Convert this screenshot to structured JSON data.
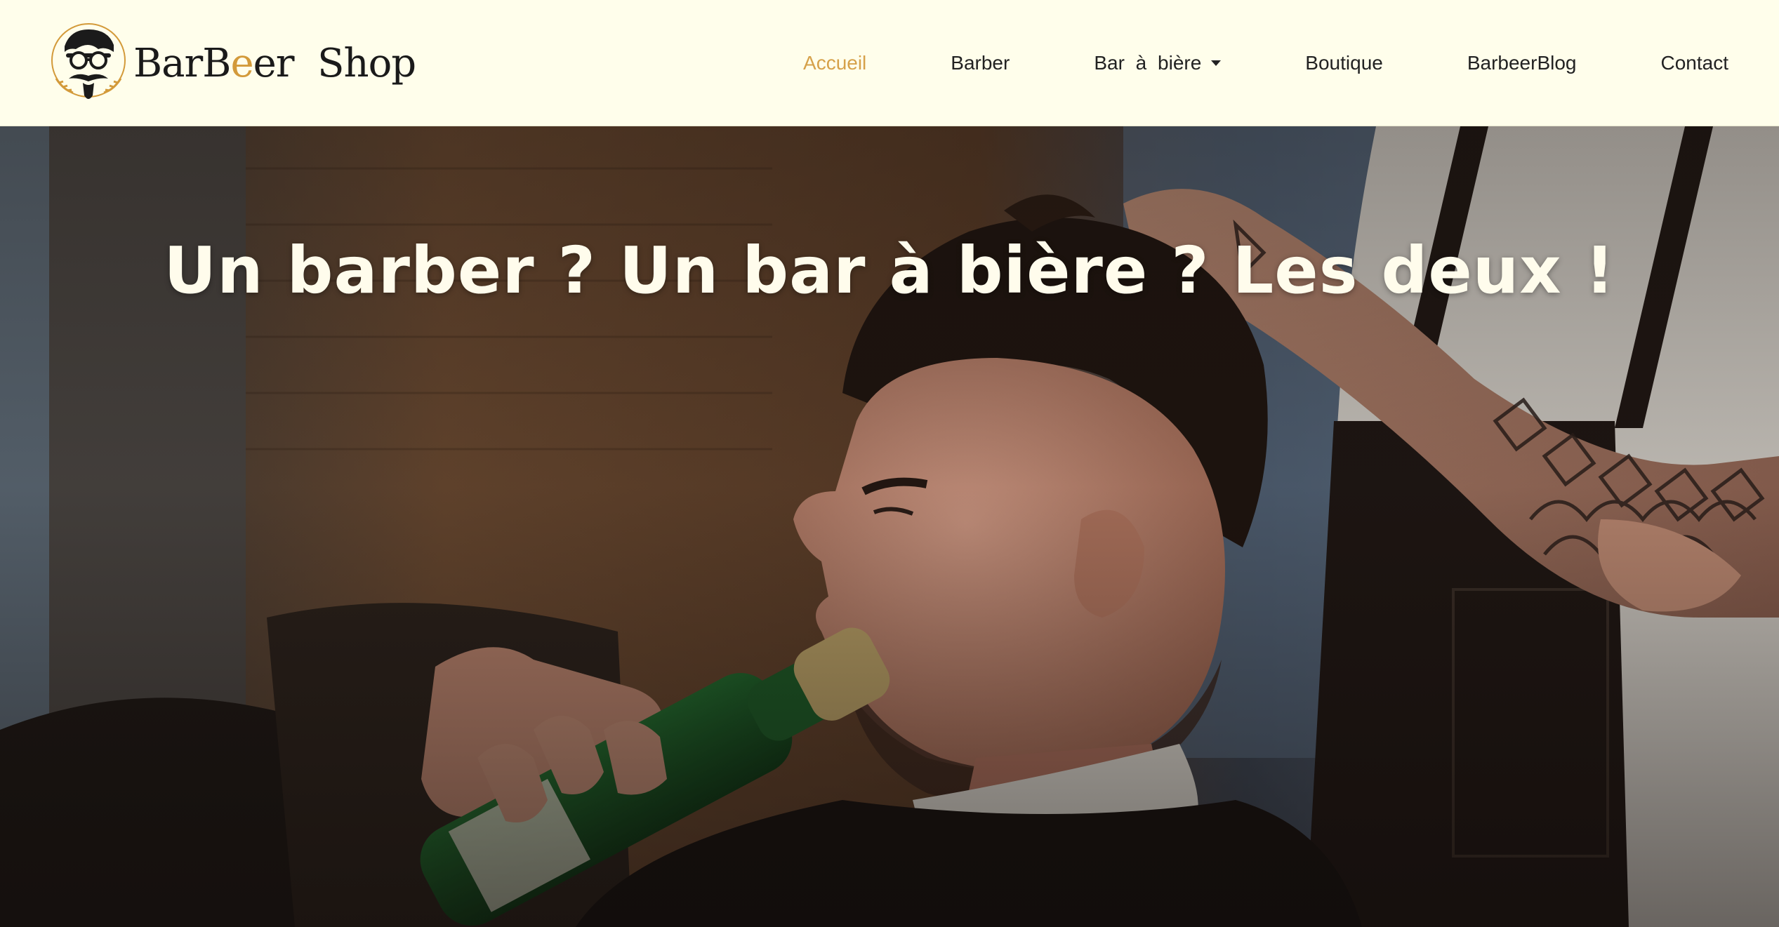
{
  "brand": {
    "name_part1": "BarB",
    "name_accent": "e",
    "name_part2": "er",
    "name_part3": "Shop",
    "logo_icon": "bearded-man-glasses-mustache-icon"
  },
  "nav": {
    "items": [
      {
        "label": "Accueil",
        "active": true
      },
      {
        "label": "Barber",
        "active": false
      },
      {
        "label": "Bar  à  bière",
        "active": false,
        "has_dropdown": true
      },
      {
        "label": "Boutique",
        "active": false
      },
      {
        "label": "BarbeerBlog",
        "active": false
      },
      {
        "label": "Contact",
        "active": false
      }
    ],
    "active_color": "#d6a14a"
  },
  "hero": {
    "title": "Un barber ? Un bar à bière ? Les deux !",
    "image_description": "barber-customer-drinking-beer-photo"
  },
  "colors": {
    "header_bg": "#fffeeb",
    "accent": "#d39a3a",
    "hero_text": "#fffcec"
  }
}
